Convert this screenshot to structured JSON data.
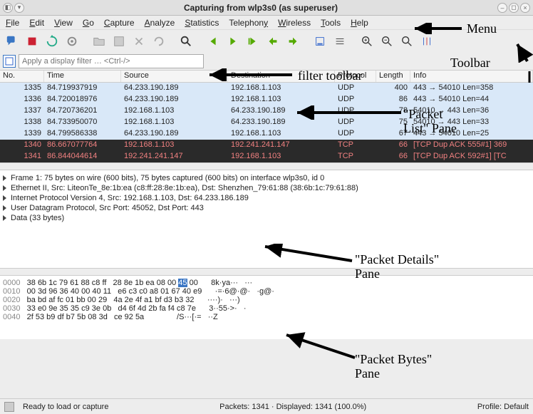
{
  "title": "Capturing from wlp3s0 (as superuser)",
  "menu": [
    "File",
    "Edit",
    "View",
    "Go",
    "Capture",
    "Analyze",
    "Statistics",
    "Telephony",
    "Wireless",
    "Tools",
    "Help"
  ],
  "filter_placeholder": "Apply a display filter … <Ctrl-/>",
  "columns": {
    "no": "No.",
    "time": "Time",
    "src": "Source",
    "dst": "Destination",
    "proto": "Protocol",
    "len": "Length",
    "info": "Info"
  },
  "packets": [
    {
      "no": "1335",
      "time": "84.719937919",
      "src": "64.233.190.189",
      "dst": "192.168.1.103",
      "proto": "UDP",
      "len": "400",
      "info": "443 → 54010 Len=358",
      "k": "udp"
    },
    {
      "no": "1336",
      "time": "84.720018976",
      "src": "64.233.190.189",
      "dst": "192.168.1.103",
      "proto": "UDP",
      "len": "86",
      "info": "443 → 54010 Len=44",
      "k": "udp"
    },
    {
      "no": "1337",
      "time": "84.720736201",
      "src": "192.168.1.103",
      "dst": "64.233.190.189",
      "proto": "UDP",
      "len": "78",
      "info": "54010 → 443 Len=36",
      "k": "udp"
    },
    {
      "no": "1338",
      "time": "84.733950070",
      "src": "192.168.1.103",
      "dst": "64.233.190.189",
      "proto": "UDP",
      "len": "75",
      "info": "54010 → 443 Len=33",
      "k": "udp"
    },
    {
      "no": "1339",
      "time": "84.799586338",
      "src": "64.233.190.189",
      "dst": "192.168.1.103",
      "proto": "UDP",
      "len": "67",
      "info": "443 → 54010 Len=25",
      "k": "udp"
    },
    {
      "no": "1340",
      "time": "86.667077764",
      "src": "192.168.1.103",
      "dst": "192.241.241.147",
      "proto": "TCP",
      "len": "66",
      "info": "[TCP Dup ACK 555#1] 369",
      "k": "tcp"
    },
    {
      "no": "1341",
      "time": "86.844044614",
      "src": "192.241.241.147",
      "dst": "192.168.1.103",
      "proto": "TCP",
      "len": "66",
      "info": "[TCP Dup ACK 592#1] [TC",
      "k": "tcp"
    }
  ],
  "details": [
    "Frame 1: 75 bytes on wire (600 bits), 75 bytes captured (600 bits) on interface wlp3s0, id 0",
    "Ethernet II, Src: LiteonTe_8e:1b:ea (c8:ff:28:8e:1b:ea), Dst: Shenzhen_79:61:88 (38:6b:1c:79:61:88)",
    "Internet Protocol Version 4, Src: 192.168.1.103, Dst: 64.233.186.189",
    "User Datagram Protocol, Src Port: 45052, Dst Port: 443",
    "Data (33 bytes)"
  ],
  "bytes": [
    {
      "off": "0000",
      "hex_a": "38 6b 1c 79 61 88 c8 ff   28 8e 1b ea 08 00 ",
      "hl": "45",
      "hex_b": " 00",
      "asc": "   8k·ya···   ···"
    },
    {
      "off": "0010",
      "hex_a": "00 3d 96 36 40 00 40 11   e6 c3 c0 a8 01 67 40 e9",
      "hl": "",
      "hex_b": "",
      "asc": "   ·=·6@·@·   ·g@·"
    },
    {
      "off": "0020",
      "hex_a": "ba bd af fc 01 bb 00 29   4a 2e 4f a1 bf d3 b3 32",
      "hl": "",
      "hex_b": "",
      "asc": "   ····)·   ···)"
    },
    {
      "off": "0030",
      "hex_a": "33 e0 9e 35 35 c9 3e 0b   d4 6f 4d 2b fa f4 c8 7e",
      "hl": "",
      "hex_b": "",
      "asc": "   3··55·>·   ·"
    },
    {
      "off": "0040",
      "hex_a": "2f 53 b9 df b7 5b 08 3d   ce 92 5a",
      "hl": "",
      "hex_b": "",
      "asc": "            /S···[·=   ··Z"
    }
  ],
  "status": {
    "left": "Ready to load or capture",
    "mid": "Packets: 1341 · Displayed: 1341 (100.0%)",
    "right": "Profile: Default"
  },
  "annot": {
    "menu": "Menu",
    "toolbar": "Toolbar",
    "filter": "filter toolbar",
    "list": "\"Packet\nList\" Pane",
    "details": "\"Packet Details\"\nPane",
    "bytes": "\"Packet Bytes\"\nPane"
  }
}
